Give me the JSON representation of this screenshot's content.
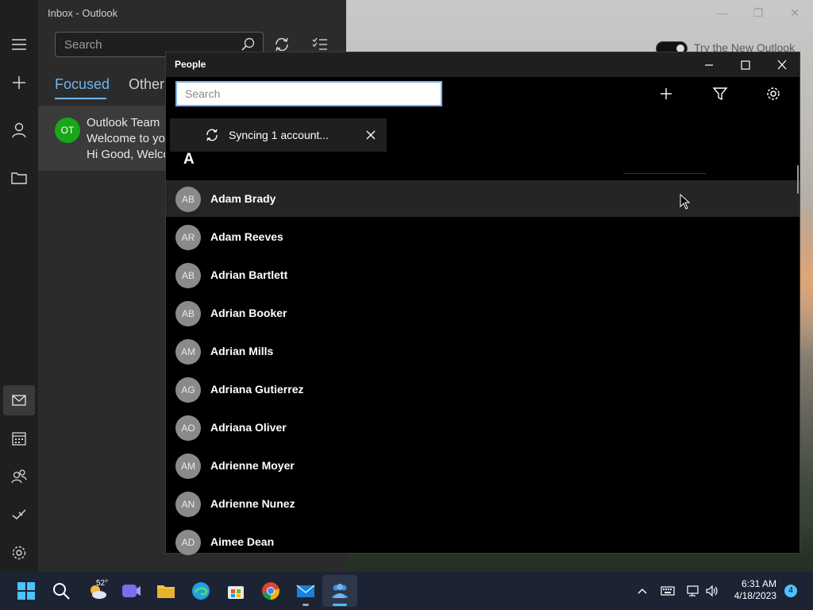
{
  "outlook": {
    "title": "Inbox - Outlook",
    "search_placeholder": "Search",
    "tabs": [
      {
        "label": "Focused",
        "active": true
      },
      {
        "label": "Other",
        "active": false
      }
    ],
    "message": {
      "avatar_initials": "OT",
      "sender": "Outlook Team",
      "subject": "Welcome to yo",
      "preview": "Hi Good, Welco"
    },
    "try_new_label": "Try the New Outlook",
    "accent_color": "#6fb4f0"
  },
  "people": {
    "title": "People",
    "search_placeholder": "Search",
    "sync_message": "Syncing 1 account...",
    "section_letter": "A",
    "contacts": [
      {
        "initials": "AB",
        "name": "Adam Brady"
      },
      {
        "initials": "AR",
        "name": "Adam Reeves"
      },
      {
        "initials": "AB",
        "name": "Adrian Bartlett"
      },
      {
        "initials": "AB",
        "name": "Adrian Booker"
      },
      {
        "initials": "AM",
        "name": "Adrian Mills"
      },
      {
        "initials": "AG",
        "name": "Adriana Gutierrez"
      },
      {
        "initials": "AO",
        "name": "Adriana Oliver"
      },
      {
        "initials": "AM",
        "name": "Adrienne Moyer"
      },
      {
        "initials": "AN",
        "name": "Adrienne Nunez"
      },
      {
        "initials": "AD",
        "name": "Aimee Dean"
      }
    ]
  },
  "taskbar": {
    "weather_temp": "52°",
    "time": "6:31 AM",
    "date": "4/18/2023",
    "notification_count": "4"
  }
}
